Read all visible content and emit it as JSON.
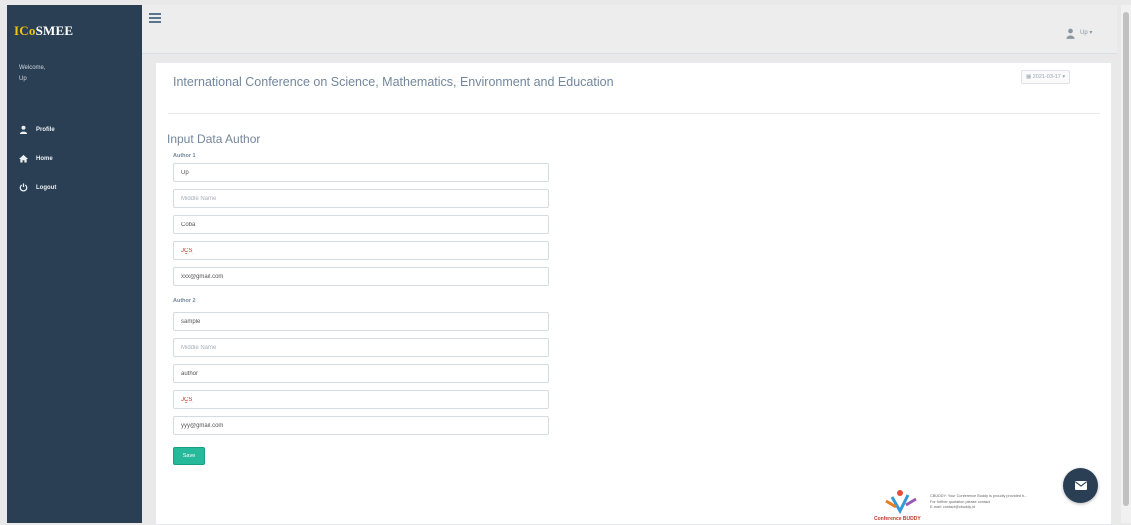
{
  "sidebar": {
    "brand": {
      "part1": "ICo",
      "part2": "SMEE"
    },
    "welcome": "Welcome,",
    "username": "Up",
    "menu": [
      {
        "label": "Profile",
        "icon": "user-icon"
      },
      {
        "label": "Home",
        "icon": "home-icon"
      },
      {
        "label": "Logout",
        "icon": "power-icon"
      }
    ]
  },
  "topbar": {
    "user_label": "Up ▾"
  },
  "panel": {
    "title": "International Conference on Science, Mathematics, Environment and Education",
    "date": "▦ 2021-03-17 ▾"
  },
  "form": {
    "section_title": "Input Data Author",
    "authors": [
      {
        "label": "Author 1",
        "first_name": "Up",
        "middle_placeholder": "Middle Name",
        "last_name": "Coba",
        "institution": "JCS",
        "email": "xxx@gmail.com"
      },
      {
        "label": "Author 2",
        "first_name": "sample",
        "middle_placeholder": "Middle Name",
        "last_name": "author",
        "institution": "JCS",
        "email": "yyy@gmail.com"
      }
    ],
    "save_label": "Save"
  },
  "footer": {
    "logo_text": "Conference BUDDY",
    "line1": "CBUDDY: Your Conference Buddy is proudly provided b...",
    "line2": "For further quotation please contact",
    "line3": "E-mail: contact@cbuddy.id"
  },
  "colors": {
    "sidebar_bg": "#2a3f54",
    "accent": "#26b99a",
    "text": "#73879c"
  }
}
